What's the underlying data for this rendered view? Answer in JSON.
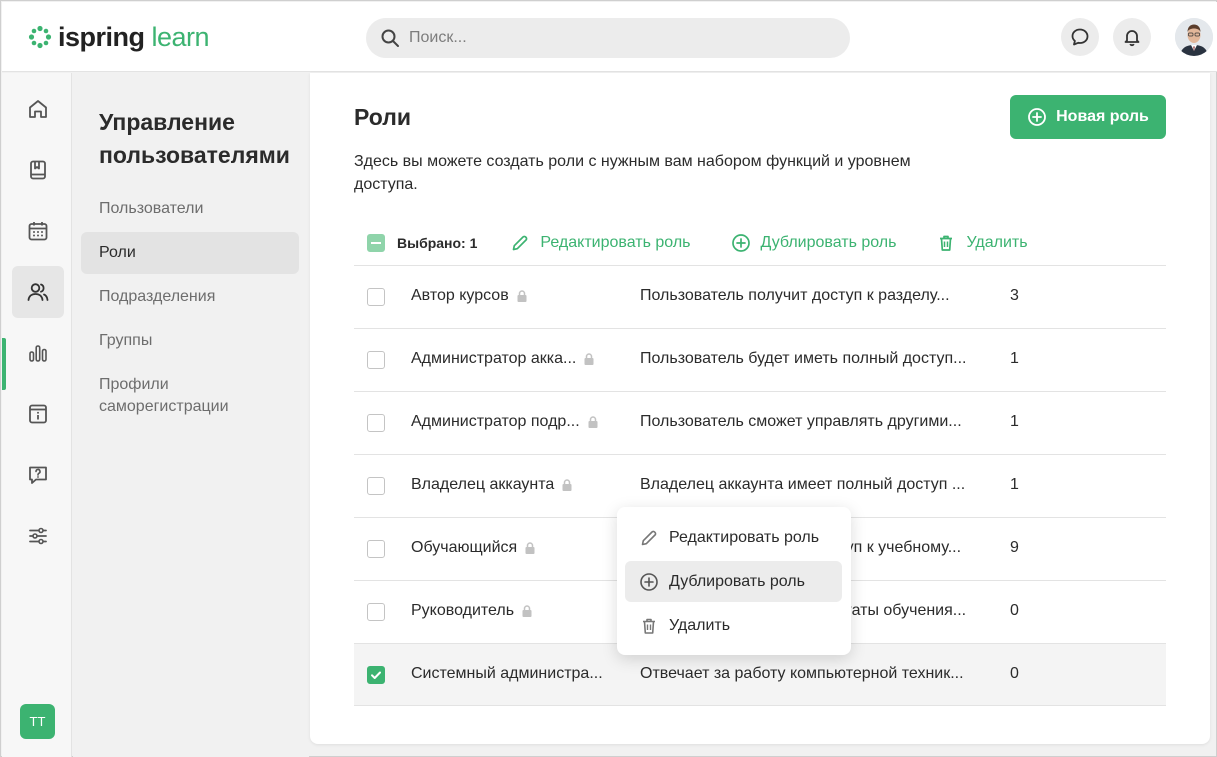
{
  "app": {
    "logo_main": "ispring",
    "logo_accent": "learn",
    "brand_color": "#3cb371"
  },
  "header": {
    "search_placeholder": "Поиск...",
    "user_initials": "ТТ"
  },
  "rail": {
    "items": [
      {
        "icon": "home-icon"
      },
      {
        "icon": "book-icon"
      },
      {
        "icon": "calendar-icon"
      },
      {
        "icon": "users-icon",
        "active": true
      },
      {
        "icon": "reports-icon"
      },
      {
        "icon": "info-icon"
      },
      {
        "icon": "help-icon"
      },
      {
        "icon": "settings-icon"
      }
    ]
  },
  "subnav": {
    "title": "Управление пользователями",
    "items": [
      {
        "label": "Пользователи"
      },
      {
        "label": "Роли",
        "active": true
      },
      {
        "label": "Подразделения"
      },
      {
        "label": "Группы"
      },
      {
        "label": "Профили саморегистрации"
      }
    ]
  },
  "main": {
    "title": "Роли",
    "new_role_label": "Новая роль",
    "description": "Здесь вы можете создать роли с нужным вам набором функций и уровнем доступа.",
    "toolbar": {
      "selected_label": "Выбрано: 1",
      "edit_label": "Редактировать роль",
      "duplicate_label": "Дублировать роль",
      "delete_label": "Удалить"
    },
    "rows": [
      {
        "name": "Автор курсов",
        "locked": true,
        "description": "Пользователь получит доступ к разделу...",
        "count": "3",
        "checked": false
      },
      {
        "name": "Администратор акка...",
        "locked": true,
        "description": "Пользователь будет иметь полный доступ...",
        "count": "1",
        "checked": false
      },
      {
        "name": "Администратор подр...",
        "locked": true,
        "description": "Пользователь сможет управлять другими...",
        "count": "1",
        "checked": false
      },
      {
        "name": "Владелец аккаунта",
        "locked": true,
        "description": "Владелец аккаунта имеет полный доступ ...",
        "count": "1",
        "checked": false
      },
      {
        "name": "Обучающийся",
        "locked": true,
        "description": "Пользователь получит доступ к учебному...",
        "count": "9",
        "checked": false
      },
      {
        "name": "Руководитель",
        "locked": true,
        "description": "Пользователь видит результаты обучения...",
        "count": "0",
        "checked": false
      },
      {
        "name": "Системный администра...",
        "locked": false,
        "description": "Отвечает за работу компьютерной техник...",
        "count": "0",
        "checked": true
      }
    ]
  },
  "context_menu": {
    "items": [
      {
        "label": "Редактировать роль",
        "icon": "pencil-icon"
      },
      {
        "label": "Дублировать роль",
        "icon": "plus-circle-icon",
        "hover": true
      },
      {
        "label": "Удалить",
        "icon": "trash-icon"
      }
    ]
  }
}
